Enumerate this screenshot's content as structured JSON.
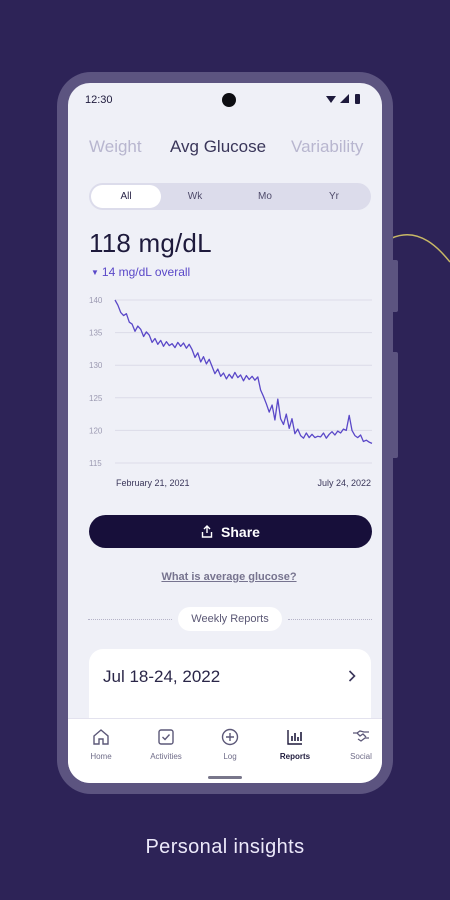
{
  "status_bar": {
    "time": "12:30"
  },
  "metric_tabs": [
    {
      "label": "Weight",
      "active": false
    },
    {
      "label": "Avg Glucose",
      "active": true
    },
    {
      "label": "Variability",
      "active": false
    }
  ],
  "range_tabs": [
    {
      "label": "All",
      "active": true
    },
    {
      "label": "Wk",
      "active": false
    },
    {
      "label": "Mo",
      "active": false
    },
    {
      "label": "Yr",
      "active": false
    }
  ],
  "summary": {
    "value": "118 mg/dL",
    "delta": "14 mg/dL overall"
  },
  "chart_data": {
    "type": "line",
    "x_start_label": "February 21, 2021",
    "x_end_label": "July 24, 2022",
    "y_ticks": [
      140,
      135,
      130,
      125,
      120,
      115
    ],
    "ylim": [
      115,
      140
    ],
    "grid": true,
    "series": [
      {
        "color": "#5a48c8",
        "values": [
          140,
          139.2,
          138.1,
          137.6,
          137.9,
          136.6,
          136.3,
          135.2,
          136.0,
          135.5,
          134.4,
          135.1,
          134.6,
          133.5,
          134.1,
          133.2,
          133.8,
          132.9,
          133.6,
          133.0,
          133.3,
          132.7,
          133.5,
          132.9,
          133.4,
          132.6,
          133.2,
          132.4,
          131.2,
          131.9,
          130.5,
          131.3,
          130.2,
          130.9,
          129.8,
          128.7,
          129.4,
          128.3,
          128.8,
          127.9,
          128.6,
          128.0,
          128.9,
          128.1,
          128.5,
          127.6,
          128.4,
          127.8,
          128.3,
          127.7,
          128.2,
          126.2,
          125.2,
          124.1,
          122.8,
          123.9,
          121.6,
          124.8,
          121.8,
          120.9,
          122.5,
          120.3,
          121.8,
          119.5,
          120.2,
          119.2,
          118.8,
          119.6,
          118.9,
          119.4,
          118.9,
          119.1,
          119.0,
          119.6,
          118.8,
          119.4,
          119.8,
          119.3,
          119.9,
          119.6,
          120.2,
          120.0,
          122.3,
          120.0,
          119.2,
          118.9,
          119.3,
          118.3,
          118.5,
          118.2,
          118.0
        ]
      }
    ]
  },
  "share_label": "Share",
  "help_link": "What is average glucose?",
  "weekly_reports_label": "Weekly Reports",
  "report_card": {
    "title": "Jul 18-24, 2022"
  },
  "bottom_nav": [
    {
      "label": "Home",
      "icon": "home-icon",
      "active": false
    },
    {
      "label": "Activities",
      "icon": "checkbox-icon",
      "active": false
    },
    {
      "label": "Log",
      "icon": "plus-circle-icon",
      "active": false
    },
    {
      "label": "Reports",
      "icon": "bar-chart-icon",
      "active": true
    },
    {
      "label": "Social",
      "icon": "handshake-icon",
      "active": false
    }
  ],
  "caption": "Personal insights",
  "colors": {
    "background": "#2d2357",
    "accent": "#5a48c8",
    "button": "#170f3a"
  }
}
